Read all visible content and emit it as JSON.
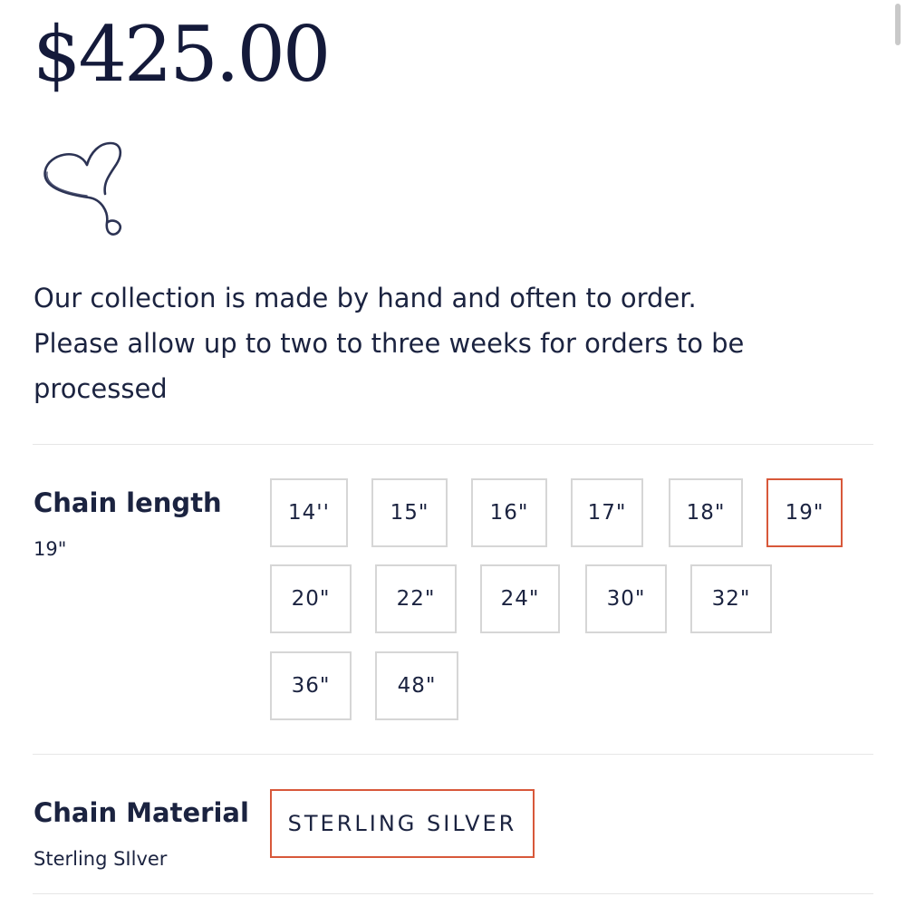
{
  "price": "$425.00",
  "icons": {
    "heart": "heart-doodle-icon"
  },
  "description": {
    "line1": "Our collection is made by hand and often to order.",
    "line2": "Please allow up to two to three weeks for orders to be",
    "line3": "processed"
  },
  "chain_length": {
    "label": "Chain length",
    "selected_value": "19\"",
    "options": [
      {
        "label": "14''",
        "selected": false
      },
      {
        "label": "15\"",
        "selected": false
      },
      {
        "label": "16\"",
        "selected": false
      },
      {
        "label": "17\"",
        "selected": false
      },
      {
        "label": "18\"",
        "selected": false
      },
      {
        "label": "19\"",
        "selected": true
      },
      {
        "label": "20\"",
        "selected": false
      },
      {
        "label": "22\"",
        "selected": false
      },
      {
        "label": "24\"",
        "selected": false
      },
      {
        "label": "30\"",
        "selected": false
      },
      {
        "label": "32\"",
        "selected": false
      },
      {
        "label": "36\"",
        "selected": false
      },
      {
        "label": "48\"",
        "selected": false
      }
    ]
  },
  "chain_material": {
    "label": "Chain Material",
    "selected_value": "Sterling SIlver",
    "options": [
      {
        "label": "STERLING SILVER",
        "selected": true
      }
    ]
  },
  "colors": {
    "text": "#1b2340",
    "selected_border": "#d8583a",
    "default_border": "#d6d6d6"
  }
}
